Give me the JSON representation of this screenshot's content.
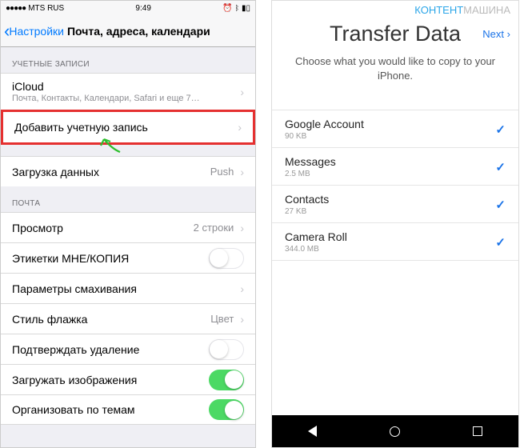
{
  "ios": {
    "status": {
      "carrier": "MTS RUS",
      "time": "9:49"
    },
    "nav": {
      "back": "Настройки",
      "title": "Почта, адреса, календари"
    },
    "section_accounts": "УЧЕТНЫЕ ЗАПИСИ",
    "icloud": {
      "title": "iCloud",
      "sub": "Почта, Контакты, Календари, Safari и еще 7…"
    },
    "add_account": "Добавить учетную запись",
    "fetch": {
      "label": "Загрузка данных",
      "value": "Push"
    },
    "section_mail": "ПОЧТА",
    "preview": {
      "label": "Просмотр",
      "value": "2 строки"
    },
    "labels": "Этикетки МНЕ/КОПИЯ",
    "swipe": "Параметры смахивания",
    "flag": {
      "label": "Стиль флажка",
      "value": "Цвет"
    },
    "confirm_delete": "Подтверждать удаление",
    "load_images": "Загружать изображения",
    "organize": "Организовать по темам"
  },
  "android": {
    "watermark1": "КОНТЕНТ",
    "watermark2": "МАШИНА",
    "next": "Next",
    "title": "Transfer Data",
    "sub": "Choose what you would like to copy to your iPhone.",
    "items": [
      {
        "name": "Google Account",
        "size": "90 KB"
      },
      {
        "name": "Messages",
        "size": "2.5 MB"
      },
      {
        "name": "Contacts",
        "size": "27 KB"
      },
      {
        "name": "Camera Roll",
        "size": "344.0 MB"
      }
    ]
  }
}
